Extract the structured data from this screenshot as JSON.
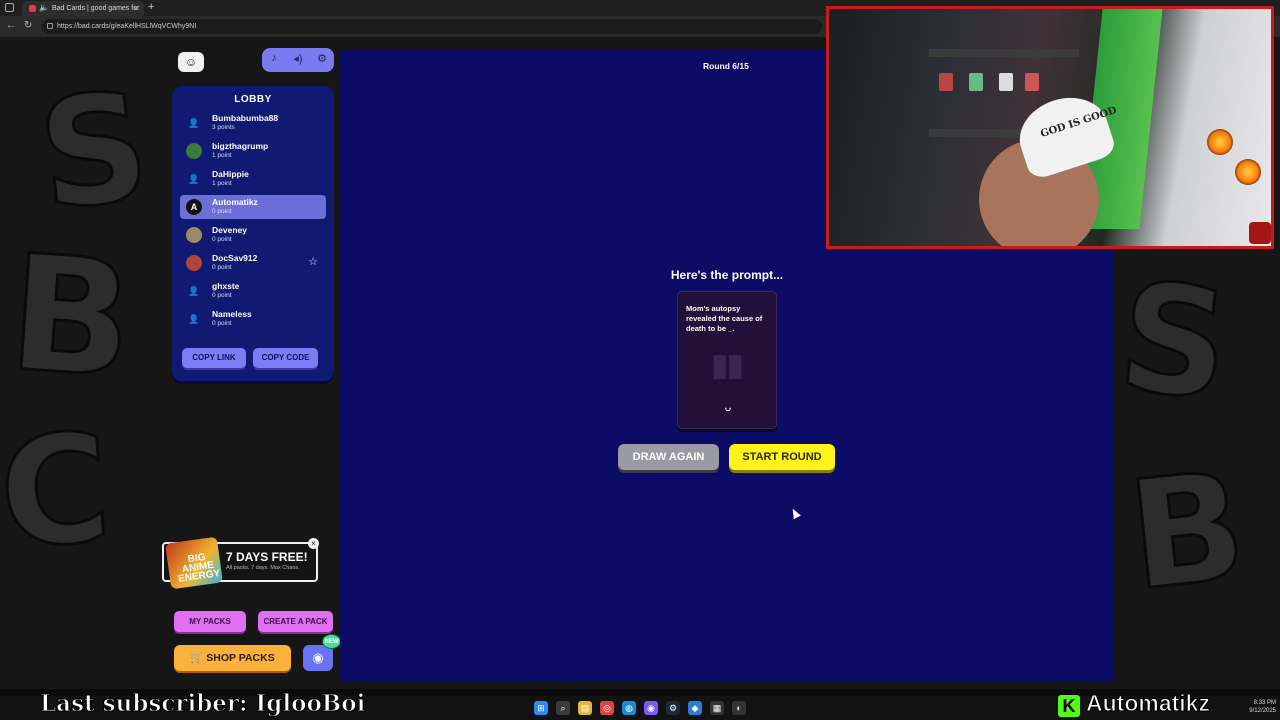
{
  "browser": {
    "tab_title": "Bad Cards | good games for",
    "url": "https://bad.cards/g/eaKellHSLlWqVCWhy9NI"
  },
  "toolbar": {
    "music_icon": "music-note-icon",
    "volume_icon": "speaker-icon",
    "settings_icon": "gear-icon"
  },
  "lobby": {
    "title": "LOBBY",
    "players": [
      {
        "name": "Bumbabumba88",
        "points": "3 points",
        "avatar": "person-icon",
        "selected": false,
        "star": false
      },
      {
        "name": "bigzthagrump",
        "points": "1 point",
        "avatar": "frog-avatar",
        "selected": false,
        "star": false
      },
      {
        "name": "DaHippie",
        "points": "1 point",
        "avatar": "person-icon",
        "selected": false,
        "star": false
      },
      {
        "name": "Automatikz",
        "points": "0 point",
        "avatar": "a-logo-avatar",
        "selected": true,
        "star": false
      },
      {
        "name": "Deveney",
        "points": "0 point",
        "avatar": "photo-avatar",
        "selected": false,
        "star": false
      },
      {
        "name": "DocSav912",
        "points": "0 point",
        "avatar": "photo-avatar",
        "selected": false,
        "star": true
      },
      {
        "name": "ghxste",
        "points": "0 point",
        "avatar": "person-icon",
        "selected": false,
        "star": false
      },
      {
        "name": "Nameless",
        "points": "0 point",
        "avatar": "person-icon",
        "selected": false,
        "star": false
      }
    ],
    "copy_link": "COPY LINK",
    "copy_code": "COPY CODE"
  },
  "promo": {
    "art_text": "BIG ANIME ENERGY",
    "title": "7 DAYS FREE!",
    "subtitle": "All packs. 7 days. Max Chaos."
  },
  "buttons": {
    "my_packs": "MY PACKS",
    "create_pack": "CREATE A PACK",
    "shop_packs": "SHOP PACKS",
    "discord_badge": "NEW"
  },
  "game": {
    "round": "Round 6/15",
    "prompt_heading": "Here's the prompt...",
    "card_text": "Mom's autopsy revealed the cause of death to be _.",
    "draw_again": "DRAW AGAIN",
    "start_round": "START ROUND"
  },
  "webcam": {
    "hat_text": "GOD IS GOOD"
  },
  "overlays": {
    "last_subscriber": "Last subscriber: IglooBoi",
    "streamer": "Automatikz"
  },
  "taskbar": {
    "time": "8:33 PM",
    "date": "9/12/2025"
  },
  "colors": {
    "board": "#0c0c66",
    "lobby_panel": "#111a73",
    "accent_blue": "#7b7df5",
    "accent_pink": "#e06ff1",
    "accent_yellow": "#fff319",
    "accent_orange": "#fbb13a",
    "webcam_border": "#c81b1b",
    "kick_green": "#53fc18"
  }
}
